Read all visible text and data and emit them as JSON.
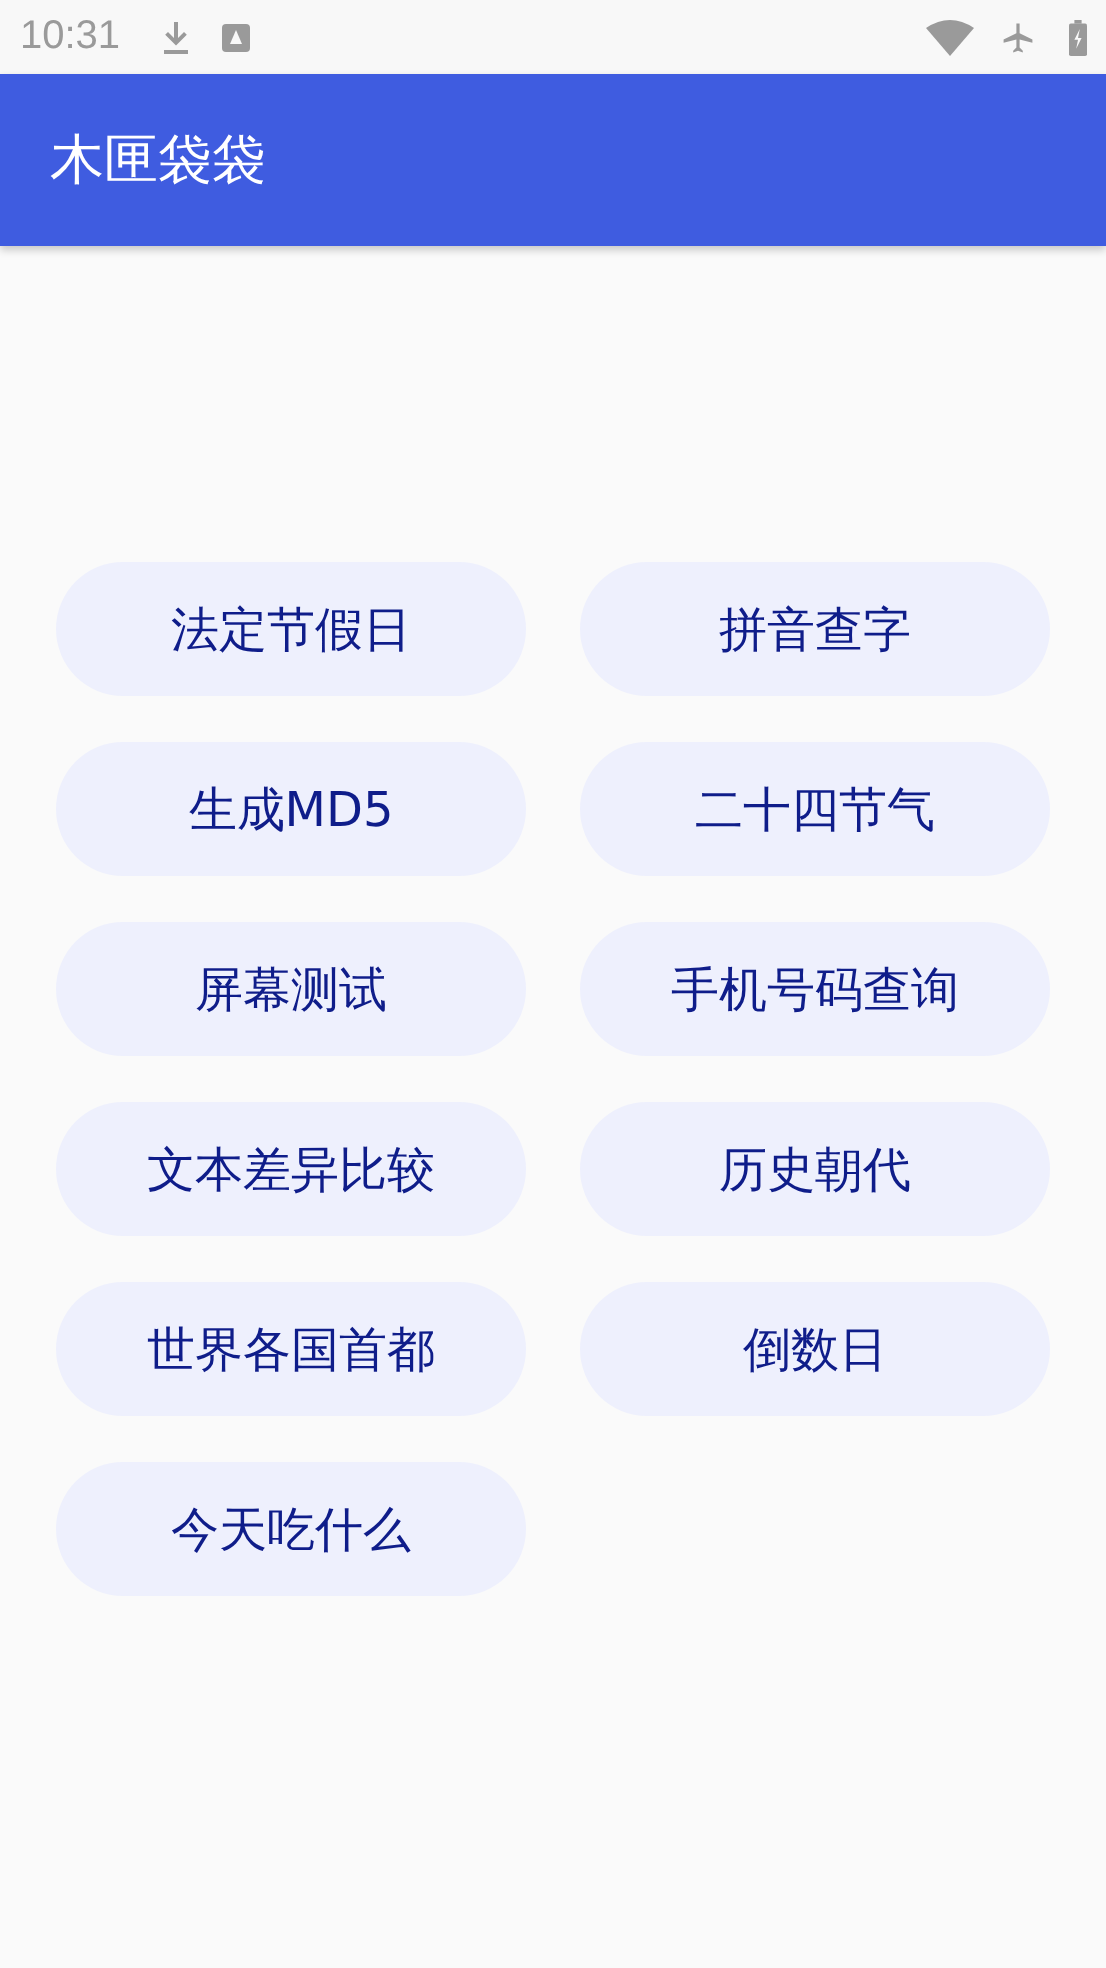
{
  "status_bar": {
    "time": "10:31"
  },
  "app_bar": {
    "title": "木匣袋袋"
  },
  "tools": [
    {
      "label": "法定节假日"
    },
    {
      "label": "拼音查字"
    },
    {
      "label": "生成MD5"
    },
    {
      "label": "二十四节气"
    },
    {
      "label": "屏幕测试"
    },
    {
      "label": "手机号码查询"
    },
    {
      "label": "文本差异比较"
    },
    {
      "label": "历史朝代"
    },
    {
      "label": "世界各国首都"
    },
    {
      "label": "倒数日"
    },
    {
      "label": "今天吃什么"
    }
  ]
}
